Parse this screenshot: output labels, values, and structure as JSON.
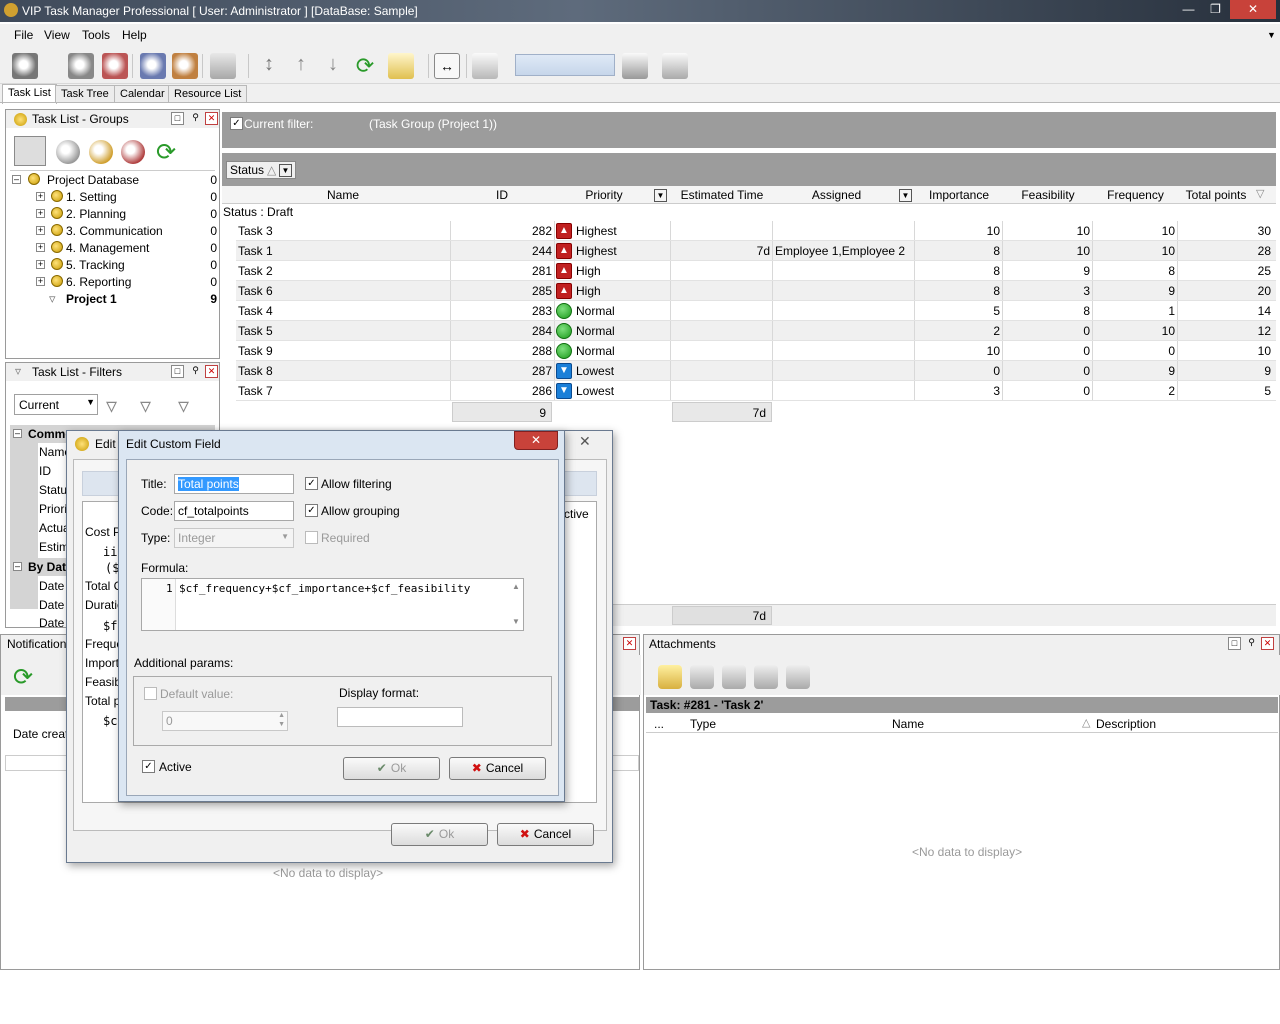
{
  "window": {
    "title": "VIP Task Manager Professional [ User: Administrator ] [DataBase: Sample]"
  },
  "menu": [
    "File",
    "View",
    "Tools",
    "Help"
  ],
  "tabs": [
    "Task List",
    "Task Tree",
    "Calendar",
    "Resource List"
  ],
  "groups_panel": {
    "title": "Task List - Groups",
    "root": {
      "label": "Project Database",
      "count": "0"
    },
    "items": [
      {
        "label": "1. Setting",
        "count": "0"
      },
      {
        "label": "2. Planning",
        "count": "0"
      },
      {
        "label": "3. Communication",
        "count": "0"
      },
      {
        "label": "4. Management",
        "count": "0"
      },
      {
        "label": "5. Tracking",
        "count": "0"
      },
      {
        "label": "6. Reporting",
        "count": "0"
      }
    ],
    "selected": {
      "label": "Project 1",
      "count": "9"
    }
  },
  "filters_panel": {
    "title": "Task List - Filters",
    "current": "Current",
    "common": "Common",
    "fields": [
      "Name",
      "ID",
      "Status",
      "Priority",
      "Actual",
      "Estim"
    ],
    "bydate": "By Date",
    "date_rows": [
      "Date",
      "Date",
      "Date"
    ]
  },
  "filter": {
    "label": "Current filter:",
    "value": "(Task Group  (Project 1))"
  },
  "group_by": {
    "label": "Status"
  },
  "grid": {
    "columns": [
      "Name",
      "ID",
      "Priority",
      "Estimated Time",
      "Assigned",
      "Importance",
      "Feasibility",
      "Frequency",
      "Total points"
    ],
    "group_label": "Status : Draft",
    "rows": [
      {
        "name": "Task 3",
        "id": "282",
        "priority": "Highest",
        "picon": "up",
        "est": "",
        "assigned": "",
        "importance": "10",
        "feasibility": "10",
        "frequency": "10",
        "total": "30"
      },
      {
        "name": "Task 1",
        "id": "244",
        "priority": "Highest",
        "picon": "up",
        "est": "7d",
        "assigned": "Employee 1,Employee 2",
        "importance": "8",
        "feasibility": "10",
        "frequency": "10",
        "total": "28"
      },
      {
        "name": "Task 2",
        "id": "281",
        "priority": "High",
        "picon": "up",
        "est": "",
        "assigned": "",
        "importance": "8",
        "feasibility": "9",
        "frequency": "8",
        "total": "25"
      },
      {
        "name": "Task 6",
        "id": "285",
        "priority": "High",
        "picon": "up",
        "est": "",
        "assigned": "",
        "importance": "8",
        "feasibility": "3",
        "frequency": "9",
        "total": "20"
      },
      {
        "name": "Task 4",
        "id": "283",
        "priority": "Normal",
        "picon": "normal",
        "est": "",
        "assigned": "",
        "importance": "5",
        "feasibility": "8",
        "frequency": "1",
        "total": "14"
      },
      {
        "name": "Task 5",
        "id": "284",
        "priority": "Normal",
        "picon": "normal",
        "est": "",
        "assigned": "",
        "importance": "2",
        "feasibility": "0",
        "frequency": "10",
        "total": "12"
      },
      {
        "name": "Task 9",
        "id": "288",
        "priority": "Normal",
        "picon": "normal",
        "est": "",
        "assigned": "",
        "importance": "10",
        "feasibility": "0",
        "frequency": "0",
        "total": "10"
      },
      {
        "name": "Task 8",
        "id": "287",
        "priority": "Lowest",
        "picon": "down",
        "est": "",
        "assigned": "",
        "importance": "0",
        "feasibility": "0",
        "frequency": "9",
        "total": "9"
      },
      {
        "name": "Task 7",
        "id": "286",
        "priority": "Lowest",
        "picon": "down",
        "est": "",
        "assigned": "",
        "importance": "3",
        "feasibility": "0",
        "frequency": "2",
        "total": "5"
      }
    ],
    "summary_id": "9",
    "summary_est": "7d",
    "footer_est": "7d"
  },
  "notifications": {
    "title": "Notifications",
    "date_created": "Date create",
    "empty": "<No data to display>"
  },
  "attachments": {
    "title": "Attachments",
    "task": "Task: #281 - 'Task 2'",
    "columns": [
      "...",
      "Type",
      "Name",
      "Description"
    ],
    "empty": "<No data to display>"
  },
  "back_dialog": {
    "title": "Edit",
    "list": [
      "Cost Pe",
      "ii",
      "($",
      "Total C",
      "Duratio",
      "$f",
      "Freque",
      "Importa",
      "Feasibi",
      "Total p",
      "$c"
    ],
    "active_col": "ctive",
    "ok": "Ok",
    "cancel": "Cancel"
  },
  "dialog": {
    "title": "Edit Custom Field",
    "title_label": "Title:",
    "title_value": "Total points",
    "code_label": "Code:",
    "code_value": "cf_totalpoints",
    "type_label": "Type:",
    "type_value": "Integer",
    "allow_filtering": "Allow filtering",
    "allow_grouping": "Allow grouping",
    "required": "Required",
    "formula_label": "Formula:",
    "formula_line_no": "1",
    "formula": "$cf_frequency+$cf_importance+$cf_feasibility",
    "additional": "Additional params:",
    "default_value_label": "Default value:",
    "default_value": "0",
    "display_format_label": "Display format:",
    "active": "Active",
    "ok": "Ok",
    "cancel": "Cancel"
  }
}
